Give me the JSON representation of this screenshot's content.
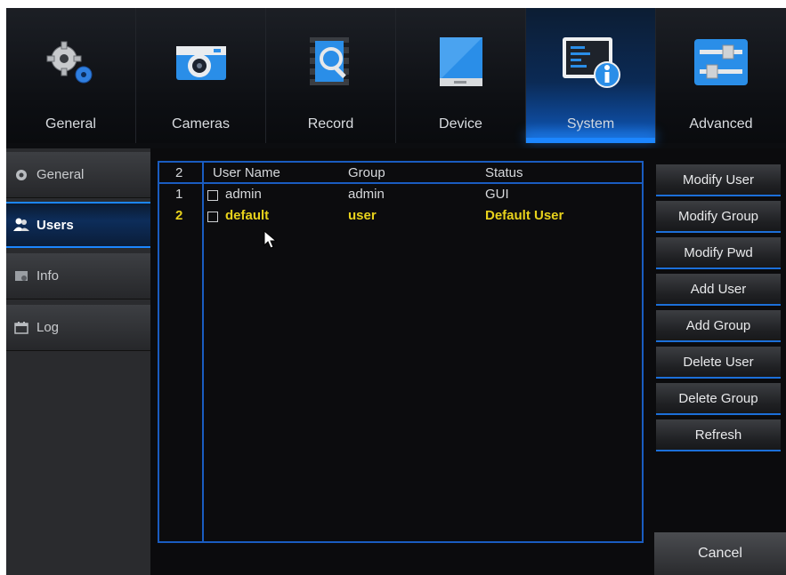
{
  "tabs": [
    {
      "label": "General",
      "icon": "gears-icon"
    },
    {
      "label": "Cameras",
      "icon": "camera-icon"
    },
    {
      "label": "Record",
      "icon": "record-search-icon"
    },
    {
      "label": "Device",
      "icon": "hard-drive-icon"
    },
    {
      "label": "System",
      "icon": "system-info-icon",
      "active": true
    },
    {
      "label": "Advanced",
      "icon": "sliders-icon"
    }
  ],
  "sidebar": {
    "items": [
      {
        "label": "General",
        "icon": "gear-icon"
      },
      {
        "label": "Users",
        "icon": "users-icon",
        "active": true
      },
      {
        "label": "Info",
        "icon": "info-icon"
      },
      {
        "label": "Log",
        "icon": "calendar-icon"
      }
    ]
  },
  "user_table": {
    "count": "2",
    "columns": [
      "User Name",
      "Group",
      "Status"
    ],
    "rows": [
      {
        "index": "1",
        "user_name": "admin",
        "group": "admin",
        "status": "GUI"
      },
      {
        "index": "2",
        "user_name": "default",
        "group": "user",
        "status": "Default User",
        "highlighted": true
      }
    ]
  },
  "actions": {
    "buttons": [
      "Modify User",
      "Modify Group",
      "Modify Pwd",
      "Add User",
      "Add Group",
      "Delete User",
      "Delete Group",
      "Refresh"
    ],
    "cancel": "Cancel"
  },
  "colors": {
    "accent": "#1c86ff",
    "highlight_text": "#e8d21c",
    "background": "#0c0d10"
  }
}
